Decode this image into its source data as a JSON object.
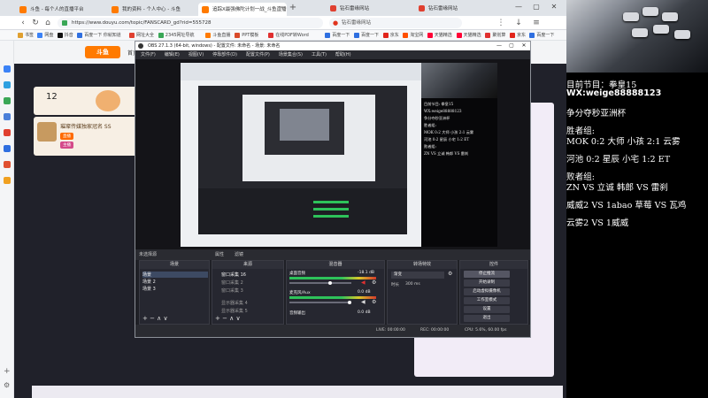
{
  "browser": {
    "tabs": [
      {
        "label": "斗鱼 - 每个人的直播平台"
      },
      {
        "label": "我的资料 - 个人中心 - 斗鱼"
      },
      {
        "label": "追踪X最强佛陀计划一战_斗鱼直播"
      }
    ],
    "right_tabs": [
      "钻石雷缘网站",
      "钻石雷缘网站"
    ],
    "window_controls": [
      "—",
      "▢",
      "✕"
    ],
    "url": "https://www.douyu.com/topic/FANSCARD_gd?rid=555728",
    "search_placeholder": "钻石雷缘网站",
    "bookmarks": [
      {
        "label": "书签",
        "color": "#e0a030"
      },
      {
        "label": "网盘",
        "color": "#3b82f6"
      },
      {
        "label": "抖音",
        "color": "#111111"
      },
      {
        "label": "百度一下 你就知道",
        "color": "#2f6fe0"
      },
      {
        "label": "网址大全",
        "color": "#e04030"
      },
      {
        "label": "2345网址导航",
        "color": "#3aa757"
      },
      {
        "label": "斗鱼直播",
        "color": "#ff7a00"
      },
      {
        "label": "PPT模板",
        "color": "#d94a2a"
      },
      {
        "label": "在线PDF转Word",
        "color": "#e03030"
      },
      {
        "label": "百度一下",
        "color": "#2f6fe0"
      },
      {
        "label": "百度一下",
        "color": "#2f6fe0"
      },
      {
        "label": "京东",
        "color": "#e1251b"
      },
      {
        "label": "淘宝网",
        "color": "#ff5000"
      },
      {
        "label": "天猫精选",
        "color": "#ff0036"
      },
      {
        "label": "天猫精选",
        "color": "#ff0036"
      },
      {
        "label": "聚划算",
        "color": "#e03030"
      },
      {
        "label": "京东",
        "color": "#e1251b"
      },
      {
        "label": "百度一下",
        "color": "#2f6fe0"
      },
      {
        "label": "天猫超市",
        "color": "#ff0036"
      },
      {
        "label": "爱淘宝",
        "color": "#ff5000"
      }
    ]
  },
  "page": {
    "nav": [
      "首页"
    ],
    "stat_number": "12",
    "ad_title": "璀璨传媒独家冠名 SS",
    "ad_badges": [
      "直播",
      "主播"
    ]
  },
  "obs": {
    "title": "OBS 27.1.3 (64-bit, windows) - 配置文件: 未命名 - 场景: 未命名",
    "menu": [
      "文件(F)",
      "编辑(E)",
      "视图(V)",
      "停靠部件(D)",
      "配置文件(P)",
      "场景集合(S)",
      "工具(T)",
      "帮助(H)"
    ],
    "toolbar": [
      "未选择源",
      "属性",
      "滤镜"
    ],
    "docks": {
      "scenes": {
        "title": "场景",
        "items": [
          "场景",
          "场景 2",
          "场景 3"
        ]
      },
      "sources": {
        "title": "来源",
        "items": [
          "窗口采集 16",
          "窗口采集 2",
          "窗口采集 3",
          "显示器采集 4",
          "显示器采集 5"
        ]
      },
      "mixer": {
        "title": "混音器",
        "channels": [
          {
            "name": "桌面音频",
            "level": "-18.1 dB"
          },
          {
            "name": "麦克风/Aux",
            "level": "0.0 dB"
          },
          {
            "name": "音频输出",
            "level": "0.0 dB"
          }
        ]
      },
      "transitions": {
        "title": "转场特效",
        "selected": "渐变",
        "duration_label": "时长",
        "duration": "300 ms"
      },
      "controls": {
        "title": "控件",
        "buttons": [
          "停止推流",
          "开始录制",
          "启动虚拟摄像机",
          "工作室模式",
          "设置",
          "退出"
        ]
      }
    },
    "footer_glyphs": "+ − ∧ ∨",
    "status": {
      "live": "LIVE: 00:00:00",
      "rec": "REC: 00:00:00",
      "cpu": "CPU: 5.6%, 60.00 fps"
    },
    "mini_overlay": [
      "目前节目: 拳皇15",
      "WX:weige88888123",
      "争分夺秒亚洲杯",
      "胜者组:",
      "MOK 0:2 大师 小孩 2:1 云雾",
      "河池 0:2 星辰 小宅 1:2 ET",
      "败者组:",
      "ZN VS 立诚 韩郎 VS 雷刹"
    ]
  },
  "overlay": {
    "program": "目前节目：拳皇15",
    "wx": "WX:weige88888123",
    "event": "争分夺秒亚洲杯",
    "winners_label": "胜者组:",
    "winners": [
      "MOK 0:2 大师 小孩 2:1 云雾",
      "河池 0:2 星辰 小宅 1:2 ET"
    ],
    "losers_label": "败者组:",
    "losers": [
      "ZN VS 立诚 韩郎 VS 雷刹",
      "威威2 VS 1abao 草莓 VS 瓦鸡",
      "云雾2 VS 1威威"
    ]
  },
  "colors": {
    "accent_orange": "#ff7a00",
    "obs_bg": "#1f2026",
    "meter_green": "#2ec25a",
    "overlay_text": "#ffffff"
  }
}
